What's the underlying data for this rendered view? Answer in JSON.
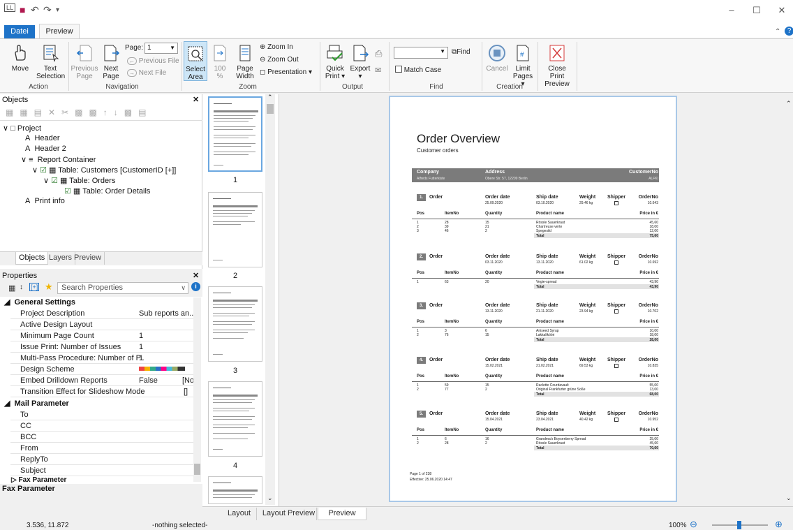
{
  "app": {
    "file_tab": "Datei",
    "active_tab": "Preview"
  },
  "ribbon": {
    "move": "Move",
    "text_selection": [
      "Text",
      "Selection"
    ],
    "previous_page": [
      "Previous",
      "Page"
    ],
    "next_page": [
      "Next",
      "Page"
    ],
    "page_label": "Page:",
    "page_value": "1",
    "previous_file": "Previous File",
    "next_file": "Next File",
    "select_area": [
      "Select",
      "Area"
    ],
    "zoom100": [
      "100",
      "%"
    ],
    "page_width": [
      "Page",
      "Width"
    ],
    "zoom_in": "Zoom In",
    "zoom_out": "Zoom Out",
    "presentation": "Presentation",
    "quick_print": [
      "Quick",
      "Print"
    ],
    "export": "Export",
    "find": "Find",
    "match_case": "Match Case",
    "cancel": "Cancel",
    "limit_pages": [
      "Limit",
      "Pages"
    ],
    "close_print_preview": [
      "Close Print",
      "Preview"
    ],
    "groups": {
      "action": "Action",
      "navigation": "Navigation",
      "zoom": "Zoom",
      "output": "Output",
      "find": "Find",
      "creation": "Creation"
    }
  },
  "objects": {
    "title": "Objects",
    "tree": [
      "Project",
      "Header",
      "Header 2",
      "Report Container",
      "Table: Customers [CustomerID [+]]",
      "Table: Orders",
      "Table: Order Details",
      "Print info"
    ],
    "tabs": [
      "Objects",
      "Layers",
      "Preview"
    ]
  },
  "properties": {
    "title": "Properties",
    "search_placeholder": "Search Properties",
    "general_settings": "General Settings",
    "rows": [
      {
        "k": "Project Description",
        "v": "Sub reports an..."
      },
      {
        "k": "Active Design Layout",
        "v": ""
      },
      {
        "k": "Minimum Page Count",
        "v": "1"
      },
      {
        "k": "Issue Print: Number of Issues",
        "v": "1"
      },
      {
        "k": "Multi-Pass Procedure: Number of P...",
        "v": "1"
      },
      {
        "k": "Design Scheme",
        "v": ""
      },
      {
        "k": "Embed Drilldown Reports",
        "v": "False",
        "v2": "[No]"
      },
      {
        "k": "Transition Effect for Slideshow Mode",
        "v": "[]"
      }
    ],
    "mail_parameter": "Mail Parameter",
    "mail_rows": [
      "To",
      "CC",
      "BCC",
      "From",
      "ReplyTo",
      "Subject"
    ],
    "fax_parameter": "Fax Parameter",
    "footer": "Fax Parameter"
  },
  "thumbs": [
    "1",
    "2",
    "3",
    "4"
  ],
  "doc": {
    "title": "Order Overview",
    "subtitle": "Customer orders",
    "hdr": {
      "company": "Company",
      "address": "Address",
      "customerno": "CustomerNo",
      "company_v": "Alfreds Futterkiste",
      "address_v": "Obere Str. 57, 12209 Berlin",
      "customerno_v": "ALFKI"
    },
    "labels": {
      "order": "Order",
      "order_date": "Order date",
      "ship_date": "Ship date",
      "weight": "Weight",
      "shipper": "Shipper",
      "orderno": "OrderNo",
      "pos": "Pos",
      "itemno": "ItemNo",
      "quantity": "Quantity",
      "product": "Product name",
      "price": "Price in €",
      "total": "Total"
    },
    "orders": [
      {
        "n": "1.",
        "od": "25.09.2020",
        "sd": "03.10.2020",
        "w": "29.46 kg",
        "no": "10.643",
        "items": [
          [
            "1",
            "28",
            "15",
            "Rössle Sauerkraut",
            "45,60"
          ],
          [
            "2",
            "39",
            "21",
            "Chartreuse verte",
            "18,00"
          ],
          [
            "3",
            "46",
            "2",
            "Spegesild",
            "12,00"
          ]
        ],
        "total": "75,60"
      },
      {
        "n": "2.",
        "od": "03.11.2020",
        "sd": "13.11.2020",
        "w": "61.02 kg",
        "no": "10.692",
        "items": [
          [
            "1",
            "63",
            "20",
            "Vegie-spread",
            "43,90"
          ]
        ],
        "total": "43,90"
      },
      {
        "n": "3.",
        "od": "13.11.2020",
        "sd": "21.11.2020",
        "w": "23.94 kg",
        "no": "10.702",
        "items": [
          [
            "1",
            "3",
            "6",
            "Aniseed Syrup",
            "10,00"
          ],
          [
            "2",
            "76",
            "15",
            "Lakkalikööri",
            "18,00"
          ]
        ],
        "total": "28,00"
      },
      {
        "n": "4.",
        "od": "15.02.2021",
        "sd": "21.02.2021",
        "w": "69.53 kg",
        "no": "10.835",
        "items": [
          [
            "1",
            "59",
            "15",
            "Raclette Courdavault",
            "55,00"
          ],
          [
            "2",
            "77",
            "2",
            "Original Frankfurter grüne Soße",
            "13,00"
          ]
        ],
        "total": "68,00"
      },
      {
        "n": "5.",
        "od": "15.04.2021",
        "sd": "23.04.2021",
        "w": "40.42 kg",
        "no": "10.952",
        "items": [
          [
            "1",
            "6",
            "16",
            "Grandma's Boysenberry Spread",
            "25,00"
          ],
          [
            "2",
            "28",
            "2",
            "Rössle Sauerkraut",
            "45,60"
          ]
        ],
        "total": "70,60"
      }
    ],
    "footer1": "Page 1 of 238",
    "footer2": "Effective: 25.06.2020 14:47"
  },
  "bottom_tabs": [
    "Layout",
    "Layout Preview",
    "Preview"
  ],
  "status": {
    "coords": "3.536, 11.872",
    "selection": "-nothing selected-",
    "zoom": "100%"
  }
}
